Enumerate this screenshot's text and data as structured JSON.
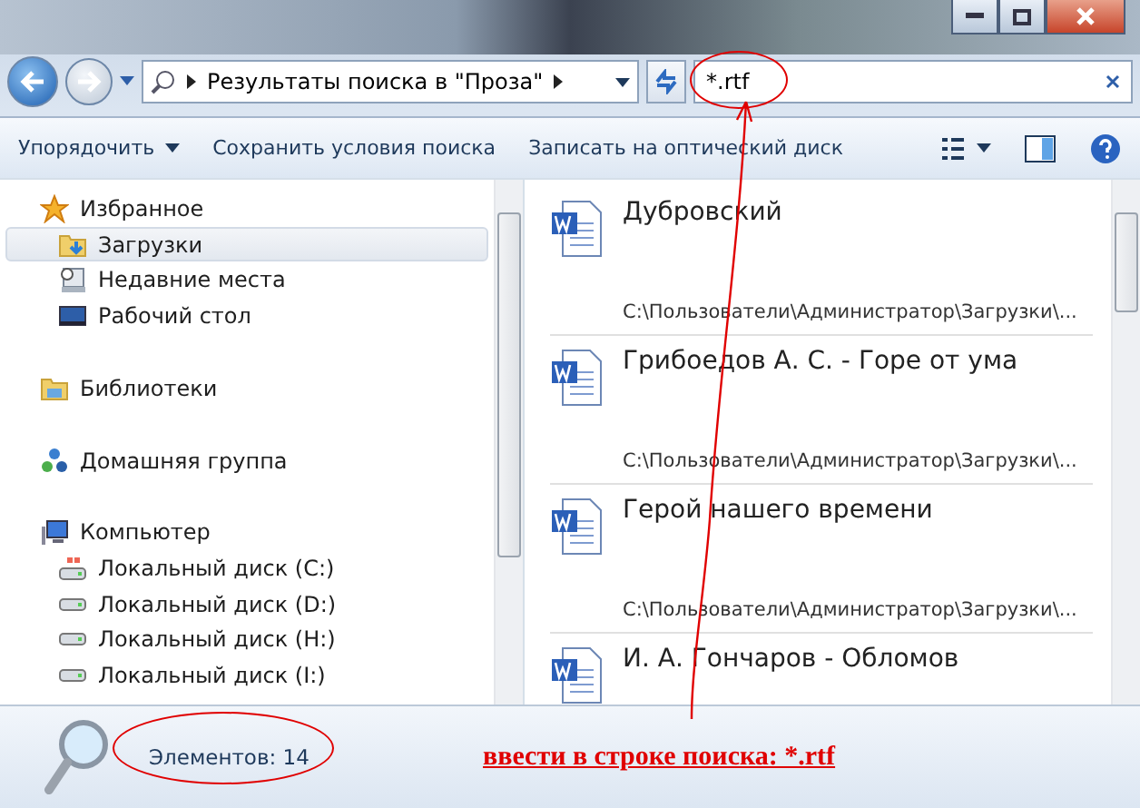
{
  "address": {
    "breadcrumb": "Результаты поиска в \"Проза\""
  },
  "search": {
    "value": "*.rtf"
  },
  "toolbar": [
    "Упорядочить",
    "Сохранить условия поиска",
    "Записать на оптический диск"
  ],
  "sidebar": {
    "groups": [
      {
        "kind": "favorites",
        "label": "Избранное",
        "children": [
          {
            "kind": "downloads",
            "label": "Загрузки",
            "selected": true
          },
          {
            "kind": "recent",
            "label": "Недавние места",
            "selected": false
          },
          {
            "kind": "desktop",
            "label": "Рабочий стол",
            "selected": false
          }
        ]
      },
      {
        "kind": "libraries",
        "label": "Библиотеки"
      },
      {
        "kind": "homegroup",
        "label": "Домашняя группа"
      },
      {
        "kind": "computer",
        "label": "Компьютер",
        "children": [
          {
            "kind": "system-disk",
            "label": "Локальный диск (C:)",
            "selected": false
          },
          {
            "kind": "disk",
            "label": "Локальный диск (D:)",
            "selected": false
          },
          {
            "kind": "disk",
            "label": "Локальный диск (H:)",
            "selected": false
          },
          {
            "kind": "disk",
            "label": "Локальный диск (I:)",
            "selected": false
          }
        ]
      }
    ]
  },
  "results": [
    {
      "name": "Дубровский",
      "path": "C:\\Пользователи\\Администратор\\Загрузки\\..."
    },
    {
      "name": "Грибоедов А. С. - Горе от ума",
      "path": "C:\\Пользователи\\Администратор\\Загрузки\\..."
    },
    {
      "name": "Герой нашего времени",
      "path": "C:\\Пользователи\\Администратор\\Загрузки\\..."
    },
    {
      "name": "И. А. Гончаров - Обломов"
    }
  ],
  "status_bar": {
    "count": "Элементов: 14"
  },
  "annotation": {
    "text": "ввести в строке поиска:  *.rtf"
  }
}
